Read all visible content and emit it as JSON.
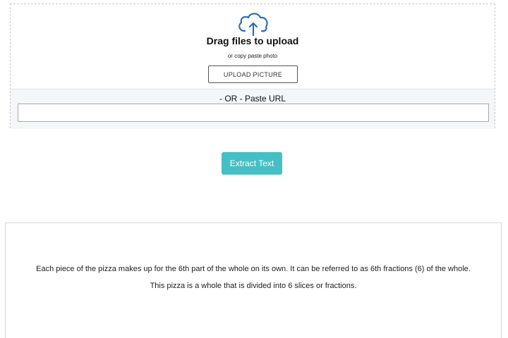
{
  "upload": {
    "icon": "cloud-upload-icon",
    "title": "Drag files to upload",
    "subtitle": "or copy paste photo",
    "upload_button_label": "UPLOAD PICTURE",
    "url_label": "- OR - Paste URL",
    "url_value": "",
    "url_placeholder": ""
  },
  "actions": {
    "extract_button_label": "Extract Text",
    "extract_button_color": "#45bfc4"
  },
  "result": {
    "lines": [
      "Each piece of the pizza makes up for the 6th part of the whole on its own. It can be referred to as 6th fractions (6) of the whole.",
      "This pizza is a whole that is divided into 6 slices or fractions."
    ]
  },
  "colors": {
    "icon_stroke": "#2d6fae",
    "url_section_bg": "#f4f6f8"
  }
}
